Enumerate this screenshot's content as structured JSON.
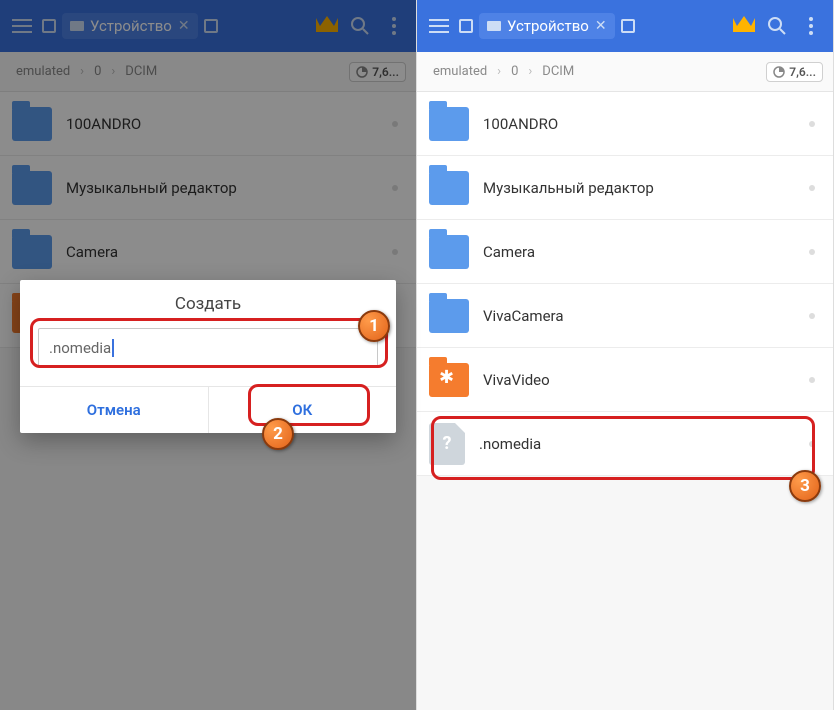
{
  "topbar": {
    "tab_label": "Устройство"
  },
  "breadcrumb": {
    "crumb1": "emulated",
    "crumb2": "0",
    "crumb3": "DCIM",
    "storage": "7,6..."
  },
  "left": {
    "items": [
      "100ANDRO",
      "Музыкальный редактор",
      "Camera"
    ]
  },
  "right": {
    "items": [
      "100ANDRO",
      "Музыкальный редактор",
      "Camera",
      "VivaCamera",
      "VivaVideo",
      ".nomedia"
    ]
  },
  "dialog": {
    "title": "Создать",
    "input_value": ".nomedia",
    "cancel": "Отмена",
    "ok": "ОК"
  },
  "badges": {
    "b1": "1",
    "b2": "2",
    "b3": "3"
  }
}
